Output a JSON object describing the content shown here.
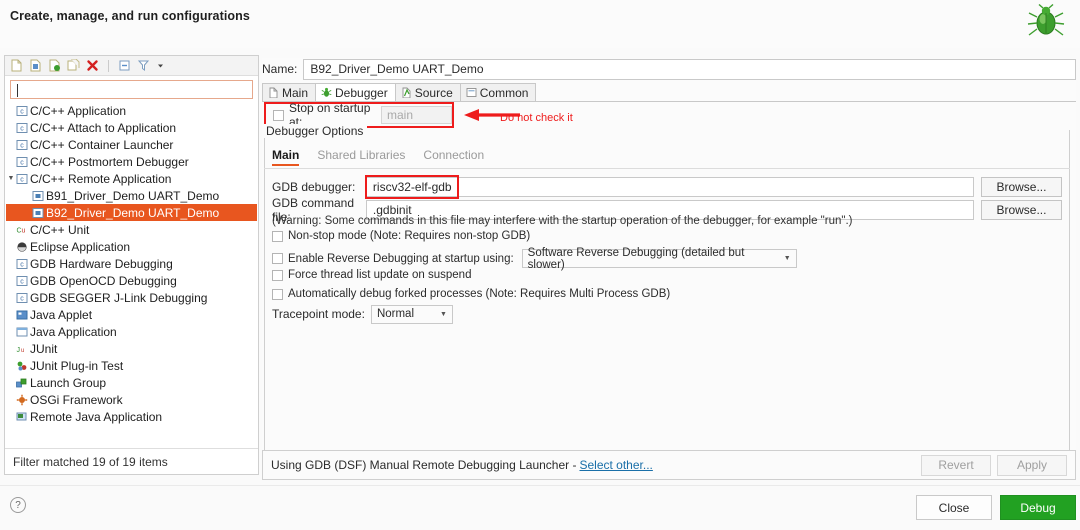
{
  "header": {
    "title": "Create, manage, and run configurations",
    "badge_icon": "green-bug-icon"
  },
  "left_panel": {
    "toolbar_icons": [
      "new-config-icon",
      "new-prototype-icon",
      "export-icon",
      "duplicate-icon",
      "delete-icon",
      "collapse-all-icon",
      "filter-icon",
      "view-menu-icon"
    ],
    "filter_input": {
      "value": "",
      "placeholder": ""
    },
    "tree": [
      {
        "label": "C/C++ Application",
        "level": 0,
        "icon": "c-app-icon",
        "selected": false,
        "arrow": ""
      },
      {
        "label": "C/C++ Attach to Application",
        "level": 0,
        "icon": "c-app-icon",
        "selected": false,
        "arrow": ""
      },
      {
        "label": "C/C++ Container Launcher",
        "level": 0,
        "icon": "c-app-icon",
        "selected": false,
        "arrow": ""
      },
      {
        "label": "C/C++ Postmortem Debugger",
        "level": 0,
        "icon": "c-app-icon",
        "selected": false,
        "arrow": ""
      },
      {
        "label": "C/C++ Remote Application",
        "level": 0,
        "icon": "c-app-icon",
        "selected": false,
        "arrow": "expanded"
      },
      {
        "label": "B91_Driver_Demo UART_Demo",
        "level": 1,
        "icon": "config-icon",
        "selected": false,
        "arrow": ""
      },
      {
        "label": "B92_Driver_Demo UART_Demo",
        "level": 1,
        "icon": "config-icon",
        "selected": true,
        "arrow": ""
      },
      {
        "label": "C/C++ Unit",
        "level": 0,
        "icon": "cunit-icon",
        "selected": false,
        "arrow": ""
      },
      {
        "label": "Eclipse Application",
        "level": 0,
        "icon": "eclipse-icon",
        "selected": false,
        "arrow": ""
      },
      {
        "label": "GDB Hardware Debugging",
        "level": 0,
        "icon": "c-app-icon",
        "selected": false,
        "arrow": ""
      },
      {
        "label": "GDB OpenOCD Debugging",
        "level": 0,
        "icon": "c-app-icon",
        "selected": false,
        "arrow": ""
      },
      {
        "label": "GDB SEGGER J-Link Debugging",
        "level": 0,
        "icon": "c-app-icon",
        "selected": false,
        "arrow": ""
      },
      {
        "label": "Java Applet",
        "level": 0,
        "icon": "java-applet-icon",
        "selected": false,
        "arrow": ""
      },
      {
        "label": "Java Application",
        "level": 0,
        "icon": "java-app-icon",
        "selected": false,
        "arrow": ""
      },
      {
        "label": "JUnit",
        "level": 0,
        "icon": "junit-icon",
        "selected": false,
        "arrow": ""
      },
      {
        "label": "JUnit Plug-in Test",
        "level": 0,
        "icon": "junit-plugin-icon",
        "selected": false,
        "arrow": ""
      },
      {
        "label": "Launch Group",
        "level": 0,
        "icon": "launch-group-icon",
        "selected": false,
        "arrow": ""
      },
      {
        "label": "OSGi Framework",
        "level": 0,
        "icon": "osgi-icon",
        "selected": false,
        "arrow": ""
      },
      {
        "label": "Remote Java Application",
        "level": 0,
        "icon": "remote-java-icon",
        "selected": false,
        "arrow": ""
      }
    ],
    "filter_status": "Filter matched 19 of 19 items"
  },
  "right_panel": {
    "name_label": "Name:",
    "name_value": "B92_Driver_Demo UART_Demo",
    "tabs": [
      {
        "label": "Main",
        "icon": "document-icon",
        "active": false
      },
      {
        "label": "Debugger",
        "icon": "bug-icon",
        "active": true
      },
      {
        "label": "Source",
        "icon": "source-icon",
        "active": false
      },
      {
        "label": "Common",
        "icon": "common-icon",
        "active": false
      }
    ],
    "stop_on_startup": {
      "label": "Stop on startup at:",
      "checked": false,
      "input_placeholder": "main",
      "input_value": ""
    },
    "annotation": {
      "text": "Do not check it",
      "color": "#ee1c1c"
    },
    "group_title": "Debugger Options",
    "subtabs": [
      {
        "label": "Main",
        "active": true
      },
      {
        "label": "Shared Libraries",
        "active": false
      },
      {
        "label": "Connection",
        "active": false
      }
    ],
    "gdb_debugger": {
      "label": "GDB debugger:",
      "value": "riscv32-elf-gdb",
      "browse_label": "Browse..."
    },
    "gdb_command_file": {
      "label": "GDB command file:",
      "value": ".gdbinit",
      "browse_label": "Browse..."
    },
    "warning": "(Warning: Some commands in this file may interfere with the startup operation of the debugger, for example \"run\".)",
    "options": [
      {
        "label": "Non-stop mode (Note: Requires non-stop GDB)",
        "checked": false,
        "has_combo": false
      },
      {
        "label": "Enable Reverse Debugging at startup using:",
        "checked": false,
        "has_combo": true,
        "combo_value": "Software Reverse Debugging (detailed but slower)"
      },
      {
        "label": "Force thread list update on suspend",
        "checked": false,
        "has_combo": false
      },
      {
        "label": "Automatically debug forked processes (Note: Requires Multi Process GDB)",
        "checked": false,
        "has_combo": false
      }
    ],
    "tracepoint": {
      "label": "Tracepoint mode:",
      "value": "Normal"
    },
    "status_text": "Using GDB (DSF) Manual Remote Debugging Launcher -",
    "status_link": "Select other...",
    "revert_label": "Revert",
    "apply_label": "Apply"
  },
  "bottom_bar": {
    "help_icon": "help-icon",
    "help_glyph": "?",
    "close_label": "Close",
    "debug_label": "Debug"
  },
  "colors": {
    "selection_orange": "#e8561f",
    "annotation_red": "#ee1c1c",
    "debug_green": "#22a122",
    "link_blue": "#1a6fa8"
  }
}
